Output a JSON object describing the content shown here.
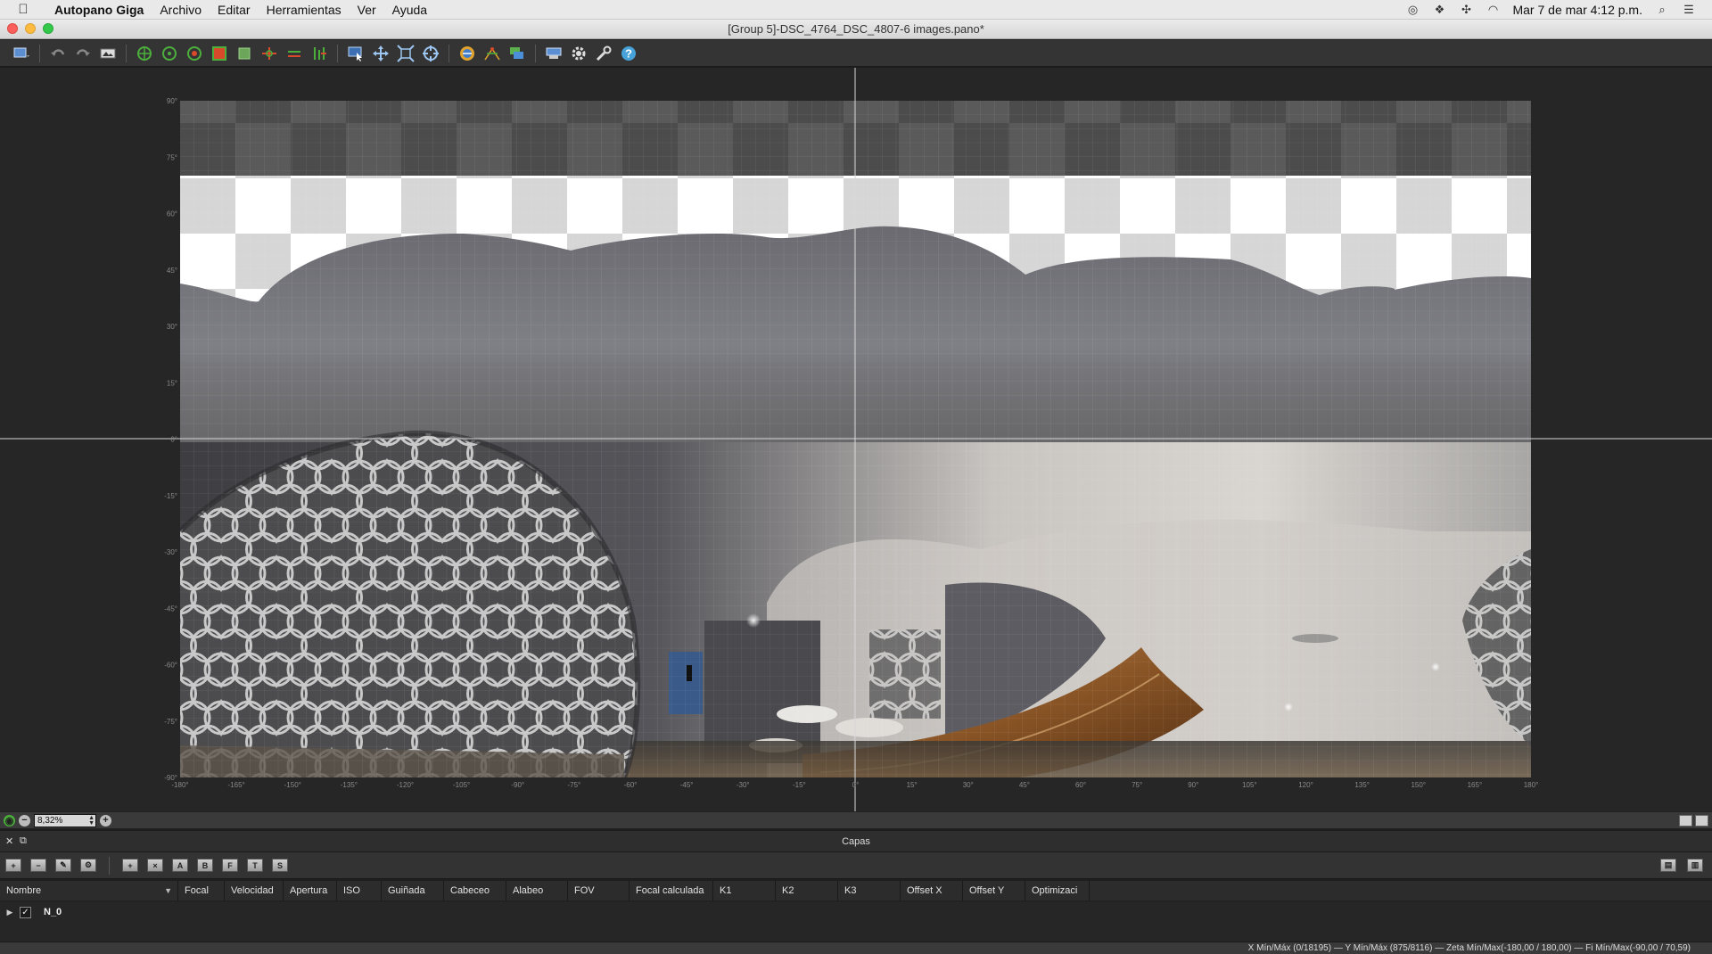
{
  "menubar": {
    "app_name": "Autopano Giga",
    "items": [
      "Archivo",
      "Editar",
      "Herramientas",
      "Ver",
      "Ayuda"
    ],
    "datetime": "Mar 7 de mar  4:12 p.m."
  },
  "window": {
    "title": "[Group 5]-DSC_4764_DSC_4807-6 images.pano*"
  },
  "viewport": {
    "y_ticks": [
      "90°",
      "75°",
      "60°",
      "45°",
      "30°",
      "15°",
      "0°",
      "-15°",
      "-30°",
      "-45°",
      "-60°",
      "-75°",
      "-90°"
    ],
    "x_ticks": [
      "-180°",
      "-165°",
      "-150°",
      "-135°",
      "-120°",
      "-105°",
      "-90°",
      "-75°",
      "-60°",
      "-45°",
      "-30°",
      "-15°",
      "0°",
      "15°",
      "30°",
      "45°",
      "60°",
      "75°",
      "90°",
      "105°",
      "120°",
      "135°",
      "150°",
      "165°",
      "180°"
    ]
  },
  "zoom": {
    "value": "8,32%"
  },
  "layers": {
    "title": "Capas",
    "toolbar_letters": [
      "A",
      "B",
      "F",
      "T",
      "S"
    ],
    "columns": [
      "Nombre",
      "Focal",
      "Velocidad",
      "Apertura",
      "ISO",
      "Guiñada",
      "Cabeceo",
      "Alabeo",
      "FOV",
      "Focal calculada",
      "K1",
      "K2",
      "K3",
      "Offset X",
      "Offset Y",
      "Optimizaci"
    ],
    "rows": [
      {
        "name": "N_0",
        "checked": "✓"
      }
    ]
  },
  "status": {
    "text": "X Mín/Máx (0/18195)  —  Y Mín/Máx (875/8116)  —  Zeta Mín/Max(-180,00 / 180,00)  —  Fi Mín/Max(-90,00 / 70,59)"
  },
  "colors": {
    "accent_green": "#4caf3c",
    "toolbar_bg": "#343434",
    "viewport_bg": "#262626"
  }
}
